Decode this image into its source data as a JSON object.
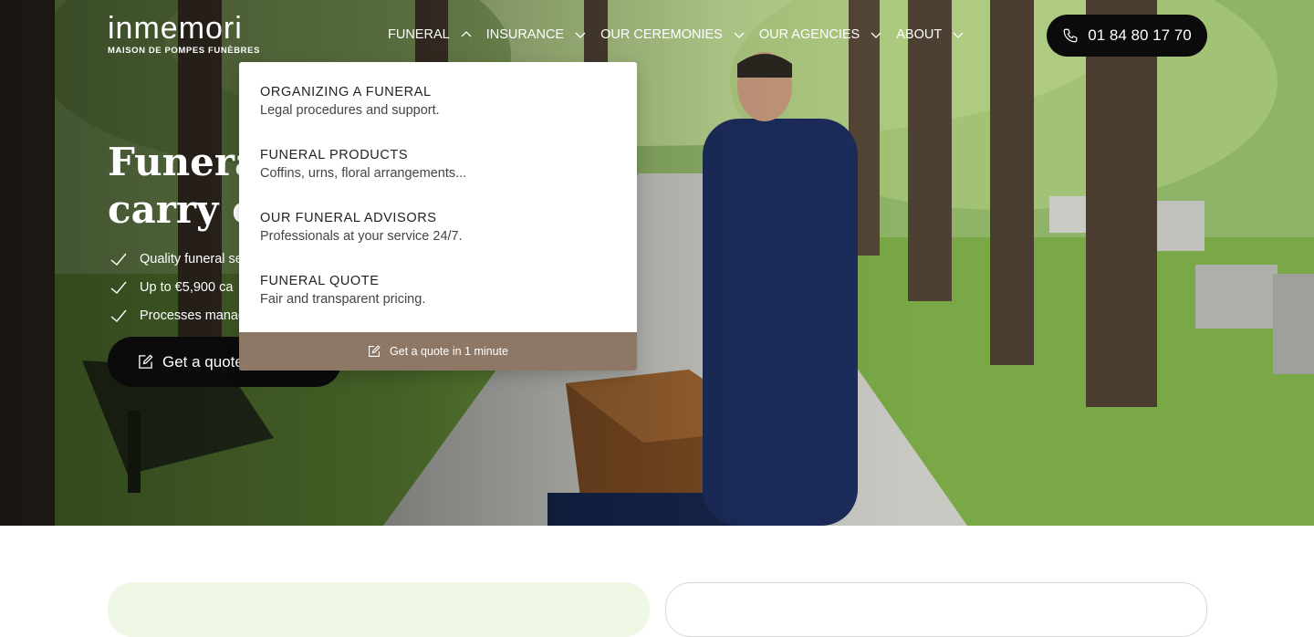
{
  "logo": {
    "wordmark": "inmemori",
    "tagline": "MAISON DE POMPES FUNÈBRES"
  },
  "nav": [
    {
      "label": "FUNERAL",
      "open": true
    },
    {
      "label": "INSURANCE",
      "open": false
    },
    {
      "label": "OUR CEREMONIES",
      "open": false
    },
    {
      "label": "OUR AGENCIES",
      "open": false
    },
    {
      "label": "ABOUT",
      "open": false
    }
  ],
  "phone": {
    "number": "01 84 80 17 70",
    "icon": "phone-icon"
  },
  "hero": {
    "title_line1": "Funeral l",
    "title_line2": "carry out",
    "bullets": [
      "Quality funeral se",
      "Up to €5,900 ca",
      "Processes manag"
    ],
    "cta": "Get a quote"
  },
  "dropdown": {
    "items": [
      {
        "title": "ORGANIZING A FUNERAL",
        "desc": "Legal procedures and support."
      },
      {
        "title": "FUNERAL PRODUCTS",
        "desc": "Coffins, urns, floral arrangements..."
      },
      {
        "title": "OUR FUNERAL ADVISORS",
        "desc": "Professionals at your service 24/7."
      },
      {
        "title": "FUNERAL QUOTE",
        "desc": "Fair and transparent pricing."
      }
    ],
    "footer": "Get a quote in 1 minute"
  },
  "colors": {
    "accent_brown": "#8e7765",
    "dark": "#0b0b0b",
    "light_green": "#eef8e4"
  }
}
